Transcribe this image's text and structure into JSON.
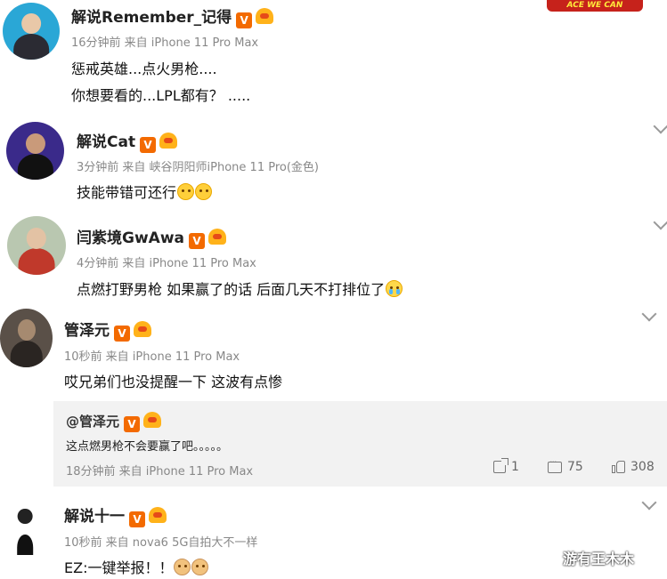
{
  "sticker_text": "ACE WE CAN",
  "comments": [
    {
      "name": "解说Remember_记得",
      "meta": "16分钟前 来自 iPhone 11 Pro Max",
      "lines": [
        "惩戒英雄...点火男枪....",
        "你想要看的...LPL都有？ ....."
      ]
    },
    {
      "name": "解说Cat",
      "meta": "3分钟前 来自 峡谷阴阳师iPhone 11 Pro(金色)",
      "lines": [
        "技能带错可还行"
      ]
    },
    {
      "name": "闫紫境GwAwa",
      "meta": "4分钟前 来自 iPhone 11 Pro Max",
      "lines": [
        "点燃打野男枪 如果赢了的话 后面几天不打排位了"
      ]
    },
    {
      "name": "管泽元",
      "meta": "10秒前 来自 iPhone 11 Pro Max",
      "lines": [
        "哎兄弟们也没提醒一下 这波有点惨"
      ]
    },
    {
      "name": "解说十一",
      "meta": "10秒前 来自 nova6 5G自拍大不一样",
      "lines": [
        "EZ:一键举报！！"
      ]
    }
  ],
  "reply": {
    "name": "@管泽元",
    "text": "这点燃男枪不会要赢了吧。。。。。",
    "meta": "18分钟前 来自 iPhone 11 Pro Max",
    "shares": "1",
    "comments": "75",
    "likes": "308"
  },
  "watermark": "游有王木木",
  "colors": {
    "vip_badge": "#f36a00",
    "reply_bg": "#f2f2f2",
    "meta_text": "#888888"
  }
}
